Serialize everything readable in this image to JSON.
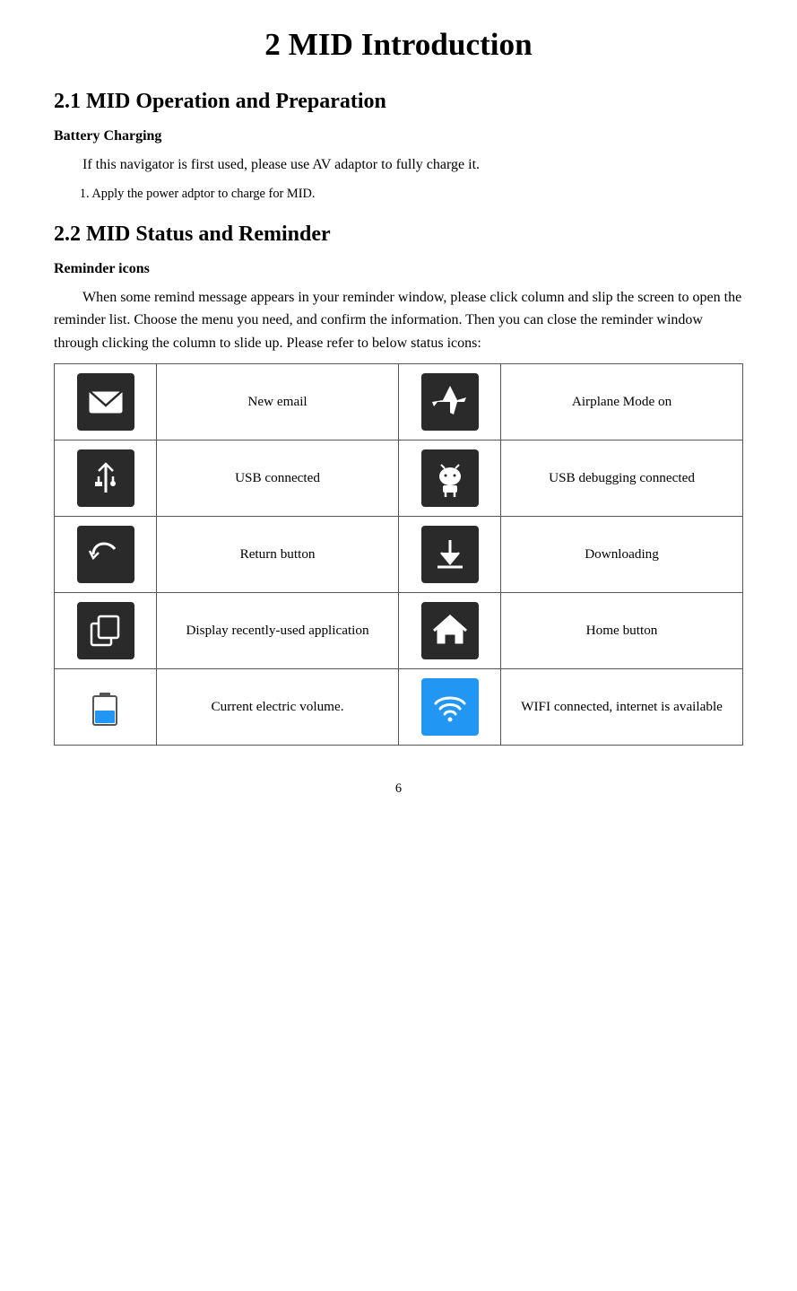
{
  "page": {
    "title": "2 MID Introduction",
    "section1": {
      "title": "2.1 MID Operation and Preparation",
      "subsection": "Battery Charging",
      "paragraph1": "If this navigator is first used, please use AV adaptor to fully charge it.",
      "paragraph2": "1. Apply the power adptor to charge for MID."
    },
    "section2": {
      "title": "2.2 MID Status and Reminder",
      "subsection": "Reminder icons",
      "paragraph": "When some remind message appears in your reminder window, please click column and slip the screen to open the reminder list. Choose the menu you need, and confirm the information. Then you can close the reminder window through clicking the column to slide up. Please refer to below status icons:"
    },
    "table": {
      "rows": [
        {
          "icon1_name": "email-icon",
          "label1": "New email",
          "icon2_name": "airplane-icon",
          "label2": "Airplane Mode on"
        },
        {
          "icon1_name": "usb-icon",
          "label1": "USB connected",
          "icon2_name": "usb-debug-icon",
          "label2": "USB debugging connected"
        },
        {
          "icon1_name": "return-icon",
          "label1": "Return button",
          "icon2_name": "download-icon",
          "label2": "Downloading"
        },
        {
          "icon1_name": "recent-apps-icon",
          "label1": "Display     recently-used application",
          "icon2_name": "home-icon",
          "label2": "Home button"
        },
        {
          "icon1_name": "battery-icon",
          "label1": "Current electric volume.",
          "icon2_name": "wifi-icon",
          "label2": "WIFI connected, internet is available"
        }
      ]
    },
    "page_number": "6"
  }
}
